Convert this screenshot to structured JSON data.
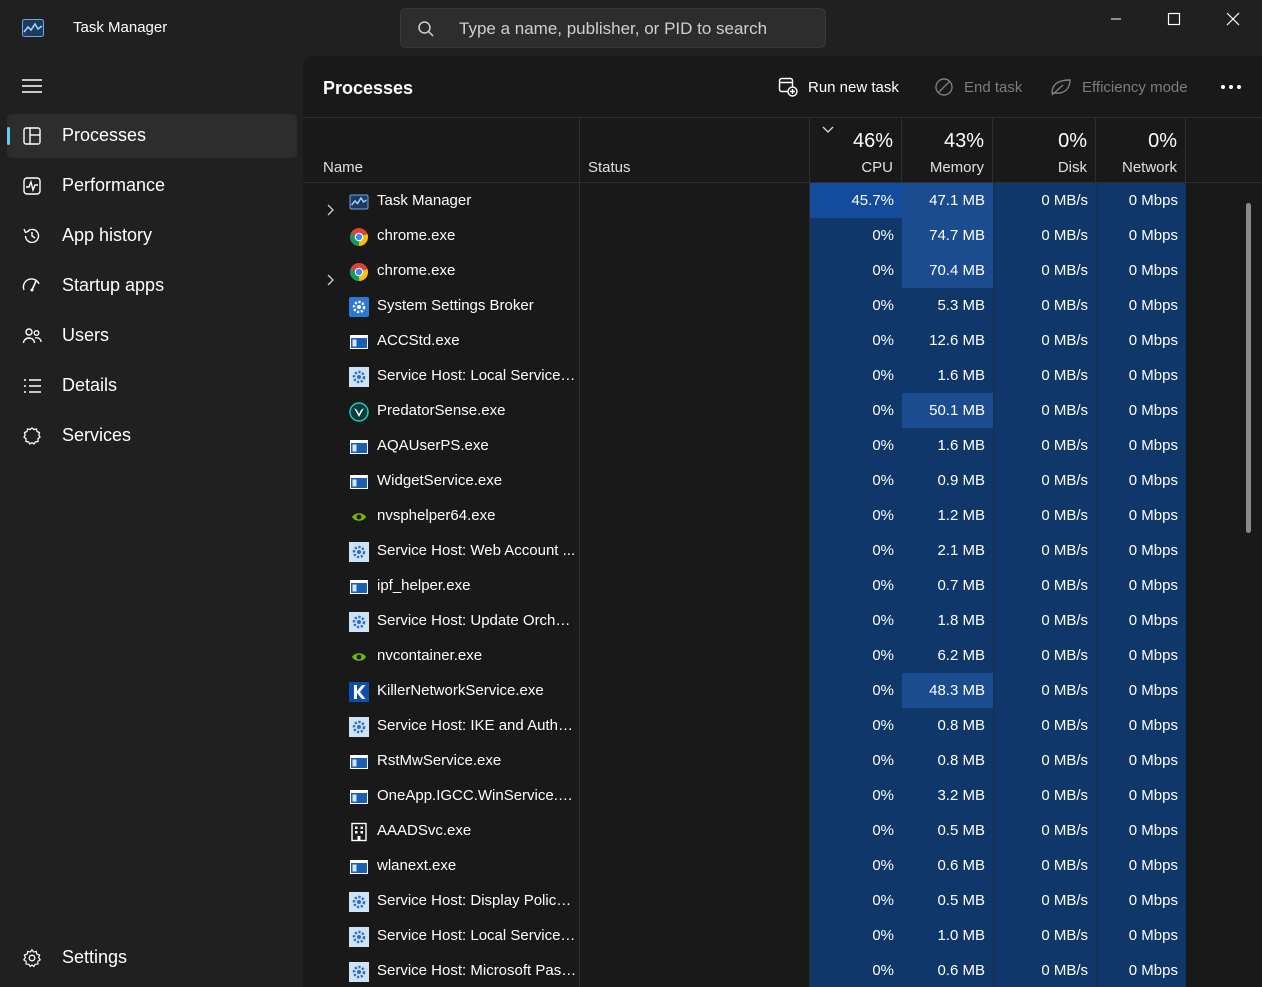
{
  "window": {
    "title": "Task Manager",
    "search_placeholder": "Type a name, publisher, or PID to search"
  },
  "sidebar": {
    "items": [
      {
        "label": "Processes",
        "icon": "processes-icon",
        "active": true
      },
      {
        "label": "Performance",
        "icon": "performance-icon"
      },
      {
        "label": "App history",
        "icon": "history-icon"
      },
      {
        "label": "Startup apps",
        "icon": "startup-icon"
      },
      {
        "label": "Users",
        "icon": "users-icon"
      },
      {
        "label": "Details",
        "icon": "details-icon"
      },
      {
        "label": "Services",
        "icon": "services-icon"
      }
    ],
    "settings_label": "Settings"
  },
  "toolbar": {
    "page_title": "Processes",
    "run_new_task": "Run new task",
    "end_task": "End task",
    "efficiency_mode": "Efficiency mode"
  },
  "columns": {
    "name": "Name",
    "status": "Status",
    "cpu": {
      "label": "CPU",
      "total": "46%"
    },
    "memory": {
      "label": "Memory",
      "total": "43%"
    },
    "disk": {
      "label": "Disk",
      "total": "0%"
    },
    "network": {
      "label": "Network",
      "total": "0%"
    }
  },
  "colors": {
    "accent": "#60cdff",
    "heat_low": "#0f3769",
    "heat_high": "#134c9d"
  },
  "processes": [
    {
      "name": "Task Manager",
      "icon": "taskmanager-icon",
      "expandable": true,
      "cpu": "45.7%",
      "memory": "47.1 MB",
      "disk": "0 MB/s",
      "network": "0 Mbps"
    },
    {
      "name": "chrome.exe",
      "icon": "chrome-icon",
      "expandable": false,
      "cpu": "0%",
      "memory": "74.7 MB",
      "disk": "0 MB/s",
      "network": "0 Mbps"
    },
    {
      "name": "chrome.exe",
      "icon": "chrome-icon",
      "expandable": true,
      "cpu": "0%",
      "memory": "70.4 MB",
      "disk": "0 MB/s",
      "network": "0 Mbps"
    },
    {
      "name": "System Settings Broker",
      "icon": "settings-gear-icon",
      "expandable": false,
      "cpu": "0%",
      "memory": "5.3 MB",
      "disk": "0 MB/s",
      "network": "0 Mbps"
    },
    {
      "name": "ACCStd.exe",
      "icon": "window-icon",
      "expandable": false,
      "cpu": "0%",
      "memory": "12.6 MB",
      "disk": "0 MB/s",
      "network": "0 Mbps"
    },
    {
      "name": "Service Host: Local Service (...",
      "icon": "service-gear-icon",
      "expandable": false,
      "cpu": "0%",
      "memory": "1.6 MB",
      "disk": "0 MB/s",
      "network": "0 Mbps"
    },
    {
      "name": "PredatorSense.exe",
      "icon": "predator-icon",
      "expandable": false,
      "cpu": "0%",
      "memory": "50.1 MB",
      "disk": "0 MB/s",
      "network": "0 Mbps"
    },
    {
      "name": "AQAUserPS.exe",
      "icon": "window-icon",
      "expandable": false,
      "cpu": "0%",
      "memory": "1.6 MB",
      "disk": "0 MB/s",
      "network": "0 Mbps"
    },
    {
      "name": "WidgetService.exe",
      "icon": "window-icon",
      "expandable": false,
      "cpu": "0%",
      "memory": "0.9 MB",
      "disk": "0 MB/s",
      "network": "0 Mbps"
    },
    {
      "name": "nvsphelper64.exe",
      "icon": "nvidia-icon",
      "expandable": false,
      "cpu": "0%",
      "memory": "1.2 MB",
      "disk": "0 MB/s",
      "network": "0 Mbps"
    },
    {
      "name": "Service Host: Web Account ...",
      "icon": "service-gear-icon",
      "expandable": false,
      "cpu": "0%",
      "memory": "2.1 MB",
      "disk": "0 MB/s",
      "network": "0 Mbps"
    },
    {
      "name": "ipf_helper.exe",
      "icon": "window-icon",
      "expandable": false,
      "cpu": "0%",
      "memory": "0.7 MB",
      "disk": "0 MB/s",
      "network": "0 Mbps"
    },
    {
      "name": "Service Host: Update Orches...",
      "icon": "service-gear-icon",
      "expandable": false,
      "cpu": "0%",
      "memory": "1.8 MB",
      "disk": "0 MB/s",
      "network": "0 Mbps"
    },
    {
      "name": "nvcontainer.exe",
      "icon": "nvidia-icon",
      "expandable": false,
      "cpu": "0%",
      "memory": "6.2 MB",
      "disk": "0 MB/s",
      "network": "0 Mbps"
    },
    {
      "name": "KillerNetworkService.exe",
      "icon": "killer-icon",
      "expandable": false,
      "cpu": "0%",
      "memory": "48.3 MB",
      "disk": "0 MB/s",
      "network": "0 Mbps"
    },
    {
      "name": "Service Host: IKE and AuthIP...",
      "icon": "service-gear-icon",
      "expandable": false,
      "cpu": "0%",
      "memory": "0.8 MB",
      "disk": "0 MB/s",
      "network": "0 Mbps"
    },
    {
      "name": "RstMwService.exe",
      "icon": "window-icon",
      "expandable": false,
      "cpu": "0%",
      "memory": "0.8 MB",
      "disk": "0 MB/s",
      "network": "0 Mbps"
    },
    {
      "name": "OneApp.IGCC.WinService.exe",
      "icon": "window-icon",
      "expandable": false,
      "cpu": "0%",
      "memory": "3.2 MB",
      "disk": "0 MB/s",
      "network": "0 Mbps"
    },
    {
      "name": "AAADSvc.exe",
      "icon": "building-icon",
      "expandable": false,
      "cpu": "0%",
      "memory": "0.5 MB",
      "disk": "0 MB/s",
      "network": "0 Mbps"
    },
    {
      "name": "wlanext.exe",
      "icon": "window-icon",
      "expandable": false,
      "cpu": "0%",
      "memory": "0.6 MB",
      "disk": "0 MB/s",
      "network": "0 Mbps"
    },
    {
      "name": "Service Host: Display Policy ...",
      "icon": "service-gear-icon",
      "expandable": false,
      "cpu": "0%",
      "memory": "0.5 MB",
      "disk": "0 MB/s",
      "network": "0 Mbps"
    },
    {
      "name": "Service Host: Local Service (...",
      "icon": "service-gear-icon",
      "expandable": false,
      "cpu": "0%",
      "memory": "1.0 MB",
      "disk": "0 MB/s",
      "network": "0 Mbps"
    },
    {
      "name": "Service Host: Microsoft Pass...",
      "icon": "service-gear-icon",
      "expandable": false,
      "cpu": "0%",
      "memory": "0.6 MB",
      "disk": "0 MB/s",
      "network": "0 Mbps"
    }
  ]
}
